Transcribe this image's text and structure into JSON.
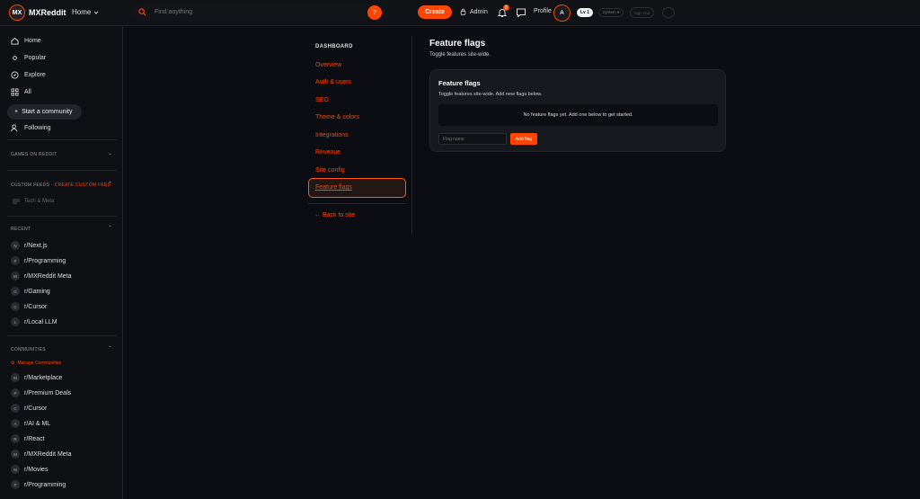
{
  "topbar": {
    "logo_text": "MX",
    "brand": "MXReddit",
    "home_label": "Home",
    "search_placeholder": "Find anything",
    "search_badge": "?",
    "create_label": "Create",
    "admin_label": "Admin",
    "notif_count": "8",
    "profile_label": "Profile",
    "avatar_letter": "A",
    "level_badge": "Lv 1",
    "system_label": "System ▾",
    "signout_label": "Sign Out"
  },
  "sidebar": {
    "main_nav": [
      {
        "label": "Home",
        "icon": "home-icon"
      },
      {
        "label": "Popular",
        "icon": "popular-icon"
      },
      {
        "label": "Explore",
        "icon": "explore-icon"
      },
      {
        "label": "All",
        "icon": "all-icon"
      }
    ],
    "start_community": "Start a community",
    "following": "Following",
    "games_header": "GAMES ON REDDIT",
    "custom_feeds_header": "CUSTOM FEEDS",
    "create_custom_feed": "CREATE CUSTOM FEED",
    "custom_feed_items": [
      "Tech & Meta"
    ],
    "recent_header": "RECENT",
    "recent": [
      {
        "badge": "N",
        "name": "r/Next.js"
      },
      {
        "badge": "P",
        "name": "r/Programming"
      },
      {
        "badge": "M",
        "name": "r/MXReddit Meta"
      },
      {
        "badge": "G",
        "name": "r/Gaming"
      },
      {
        "badge": "C",
        "name": "r/Cursor"
      },
      {
        "badge": "L",
        "name": "r/Local LLM"
      }
    ],
    "communities_header": "COMMUNITIES",
    "manage_communities": "Manage Communities",
    "communities": [
      {
        "badge": "M",
        "name": "r/Marketplace"
      },
      {
        "badge": "P",
        "name": "r/Premium Deals"
      },
      {
        "badge": "C",
        "name": "r/Cursor"
      },
      {
        "badge": "A",
        "name": "r/AI & ML"
      },
      {
        "badge": "R",
        "name": "r/React"
      },
      {
        "badge": "M",
        "name": "r/MXReddit Meta"
      },
      {
        "badge": "M",
        "name": "r/Movies"
      },
      {
        "badge": "P",
        "name": "r/Programming"
      }
    ]
  },
  "dashboard": {
    "title": "DASHBOARD",
    "links": [
      "Overview",
      "Auth & users",
      "SEO",
      "Theme & colors",
      "Integrations",
      "Revenue",
      "Site config"
    ],
    "active_link": "Feature flags",
    "back_label": "← Back to site"
  },
  "main": {
    "title": "Feature flags",
    "subtitle": "Toggle features site-wide.",
    "card": {
      "title": "Feature flags",
      "subtitle": "Toggle features site-wide. Add new flags below.",
      "empty_text": "No feature flags yet. Add one below to get started.",
      "input_placeholder": "Flag name",
      "add_button": "Add flag"
    }
  },
  "colors": {
    "accent": "#ff4500",
    "background": "#0b0d12",
    "card": "#17191e"
  }
}
